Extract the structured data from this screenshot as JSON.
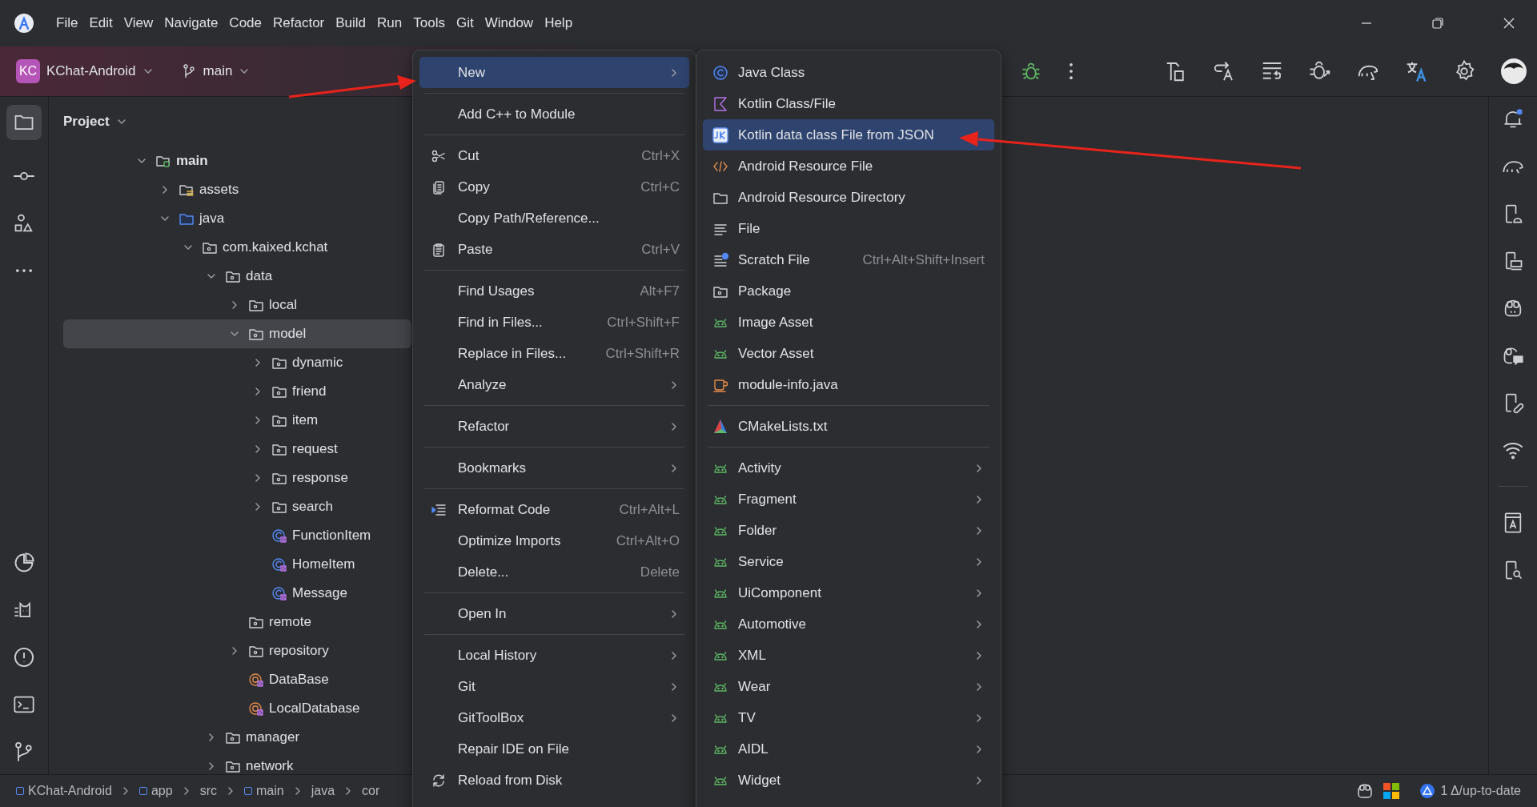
{
  "menu_bar": {
    "items": [
      "File",
      "Edit",
      "View",
      "Navigate",
      "Code",
      "Refactor",
      "Build",
      "Run",
      "Tools",
      "Git",
      "Window",
      "Help"
    ]
  },
  "toolbar": {
    "project": {
      "badge": "KC",
      "name": "KChat-Android"
    },
    "branch": "main"
  },
  "project_panel": {
    "title": "Project",
    "tree": [
      {
        "label": "main",
        "kind": "source-root",
        "expanded": true,
        "selected": false,
        "children": [
          {
            "label": "assets",
            "kind": "resources",
            "expanded": false,
            "selected": false
          },
          {
            "label": "java",
            "kind": "java-root",
            "expanded": true,
            "selected": false,
            "children": [
              {
                "label": "com.kaixed.kchat",
                "kind": "package",
                "expanded": true,
                "selected": false,
                "children": [
                  {
                    "label": "data",
                    "kind": "package",
                    "expanded": true,
                    "selected": false,
                    "children": [
                      {
                        "label": "local",
                        "kind": "package",
                        "expanded": false,
                        "selected": false
                      },
                      {
                        "label": "model",
                        "kind": "package",
                        "expanded": true,
                        "selected": true,
                        "children": [
                          {
                            "label": "dynamic",
                            "kind": "package",
                            "expanded": false,
                            "selected": false
                          },
                          {
                            "label": "friend",
                            "kind": "package",
                            "expanded": false,
                            "selected": false
                          },
                          {
                            "label": "item",
                            "kind": "package",
                            "expanded": false,
                            "selected": false
                          },
                          {
                            "label": "request",
                            "kind": "package",
                            "expanded": false,
                            "selected": false
                          },
                          {
                            "label": "response",
                            "kind": "package",
                            "expanded": false,
                            "selected": false
                          },
                          {
                            "label": "search",
                            "kind": "package",
                            "expanded": false,
                            "selected": false
                          },
                          {
                            "label": "FunctionItem",
                            "kind": "kotlin-class",
                            "selected": false
                          },
                          {
                            "label": "HomeItem",
                            "kind": "kotlin-class",
                            "selected": false
                          },
                          {
                            "label": "Message",
                            "kind": "kotlin-class",
                            "selected": false
                          }
                        ]
                      },
                      {
                        "label": "remote",
                        "kind": "package",
                        "selected": false
                      },
                      {
                        "label": "repository",
                        "kind": "package",
                        "expanded": false,
                        "selected": false
                      },
                      {
                        "label": "DataBase",
                        "kind": "kotlin-object",
                        "selected": false
                      },
                      {
                        "label": "LocalDatabase",
                        "kind": "kotlin-object",
                        "selected": false
                      }
                    ]
                  },
                  {
                    "label": "manager",
                    "kind": "package",
                    "expanded": false,
                    "selected": false
                  },
                  {
                    "label": "network",
                    "kind": "package",
                    "expanded": false,
                    "selected": false
                  }
                ]
              }
            ]
          }
        ]
      }
    ]
  },
  "context_menu": {
    "sections": [
      {
        "items": [
          {
            "label": "New",
            "submenu": true,
            "selected": true
          }
        ]
      },
      {
        "items": [
          {
            "label": "Add C++ to Module",
            "submenu": false,
            "selected": false
          }
        ]
      },
      {
        "items": [
          {
            "label": "Cut",
            "kind": "scissors",
            "shortcut": "Ctrl+X",
            "submenu": false,
            "selected": false
          },
          {
            "label": "Copy",
            "kind": "copy",
            "shortcut": "Ctrl+C",
            "submenu": false,
            "selected": false
          },
          {
            "label": "Copy Path/Reference...",
            "submenu": false,
            "selected": false
          },
          {
            "label": "Paste",
            "kind": "paste",
            "shortcut": "Ctrl+V",
            "submenu": false,
            "selected": false
          }
        ]
      },
      {
        "items": [
          {
            "label": "Find Usages",
            "shortcut": "Alt+F7",
            "submenu": false,
            "selected": false
          },
          {
            "label": "Find in Files...",
            "shortcut": "Ctrl+Shift+F",
            "submenu": false,
            "selected": false
          },
          {
            "label": "Replace in Files...",
            "shortcut": "Ctrl+Shift+R",
            "submenu": false,
            "selected": false
          },
          {
            "label": "Analyze",
            "submenu": true,
            "selected": false
          }
        ]
      },
      {
        "items": [
          {
            "label": "Refactor",
            "submenu": true,
            "selected": false
          }
        ]
      },
      {
        "items": [
          {
            "label": "Bookmarks",
            "submenu": true,
            "selected": false
          }
        ]
      },
      {
        "items": [
          {
            "label": "Reformat Code",
            "kind": "reformat",
            "shortcut": "Ctrl+Alt+L",
            "submenu": false,
            "selected": false
          },
          {
            "label": "Optimize Imports",
            "shortcut": "Ctrl+Alt+O",
            "submenu": false,
            "selected": false
          },
          {
            "label": "Delete...",
            "shortcut": "Delete",
            "submenu": false,
            "selected": false
          }
        ]
      },
      {
        "items": [
          {
            "label": "Open In",
            "submenu": true,
            "selected": false
          }
        ]
      },
      {
        "items": [
          {
            "label": "Local History",
            "submenu": true,
            "selected": false
          },
          {
            "label": "Git",
            "submenu": true,
            "selected": false
          },
          {
            "label": "GitToolBox",
            "submenu": true,
            "selected": false
          },
          {
            "label": "Repair IDE on File",
            "submenu": false,
            "selected": false
          },
          {
            "label": "Reload from Disk",
            "kind": "reload",
            "submenu": false,
            "selected": false
          }
        ]
      }
    ]
  },
  "new_submenu": {
    "sections": [
      {
        "items": [
          {
            "label": "Java Class",
            "kind": "java-class",
            "submenu": false,
            "selected": false
          },
          {
            "label": "Kotlin Class/File",
            "kind": "kotlin-file",
            "submenu": false,
            "selected": false
          },
          {
            "label": "Kotlin data class File from JSON",
            "kind": "json-kotlin",
            "submenu": false,
            "selected": true
          },
          {
            "label": "Android Resource File",
            "kind": "xml",
            "submenu": false,
            "selected": false
          },
          {
            "label": "Android Resource Directory",
            "kind": "folder",
            "submenu": false,
            "selected": false
          },
          {
            "label": "File",
            "kind": "text-file",
            "submenu": false,
            "selected": false
          },
          {
            "label": "Scratch File",
            "kind": "scratch",
            "shortcut": "Ctrl+Alt+Shift+Insert",
            "submenu": false,
            "selected": false
          },
          {
            "label": "Package",
            "kind": "package",
            "submenu": false,
            "selected": false
          },
          {
            "label": "Image Asset",
            "kind": "android",
            "submenu": false,
            "selected": false
          },
          {
            "label": "Vector Asset",
            "kind": "android",
            "submenu": false,
            "selected": false
          },
          {
            "label": "module-info.java",
            "kind": "cup",
            "submenu": false,
            "selected": false
          }
        ]
      },
      {
        "items": [
          {
            "label": "CMakeLists.txt",
            "kind": "cmake",
            "submenu": false,
            "selected": false
          }
        ]
      },
      {
        "items": [
          {
            "label": "Activity",
            "kind": "android",
            "submenu": true,
            "selected": false
          },
          {
            "label": "Fragment",
            "kind": "android",
            "submenu": true,
            "selected": false
          },
          {
            "label": "Folder",
            "kind": "android",
            "submenu": true,
            "selected": false
          },
          {
            "label": "Service",
            "kind": "android",
            "submenu": true,
            "selected": false
          },
          {
            "label": "UiComponent",
            "kind": "android",
            "submenu": true,
            "selected": false
          },
          {
            "label": "Automotive",
            "kind": "android",
            "submenu": true,
            "selected": false
          },
          {
            "label": "XML",
            "kind": "android",
            "submenu": true,
            "selected": false
          },
          {
            "label": "Wear",
            "kind": "android",
            "submenu": true,
            "selected": false
          },
          {
            "label": "TV",
            "kind": "android",
            "submenu": true,
            "selected": false
          },
          {
            "label": "AIDL",
            "kind": "android",
            "submenu": true,
            "selected": false
          },
          {
            "label": "Widget",
            "kind": "android",
            "submenu": true,
            "selected": false
          }
        ]
      }
    ]
  },
  "status_bar": {
    "breadcrumbs": [
      {
        "label": "KChat-Android",
        "module": true
      },
      {
        "label": "app",
        "module": true
      },
      {
        "label": "src",
        "module": false
      },
      {
        "label": "main",
        "module": true
      },
      {
        "label": "java",
        "module": false
      },
      {
        "label": "cor",
        "module": false
      }
    ],
    "vcs_status": "1 Δ/up-to-date"
  }
}
